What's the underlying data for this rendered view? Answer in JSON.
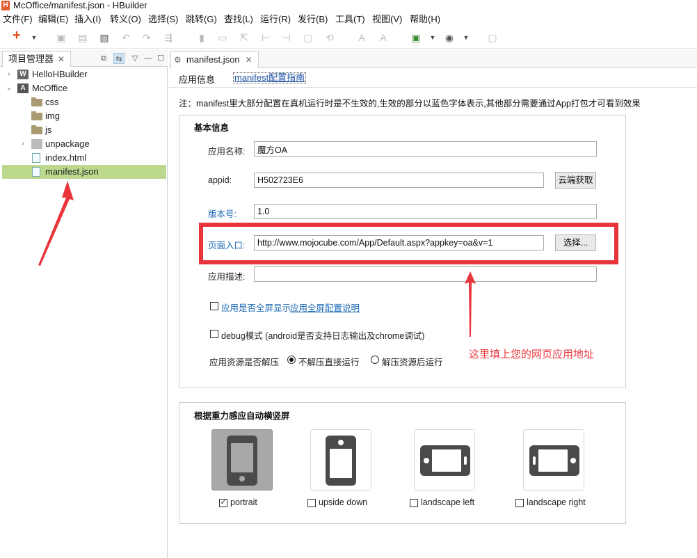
{
  "window": {
    "title": "McOffice/manifest.json  -  HBuilder",
    "app_icon": "H"
  },
  "menu": [
    "文件(F)",
    "编辑(E)",
    "插入(I)",
    "转义(O)",
    "选择(S)",
    "跳转(G)",
    "查找(L)",
    "运行(R)",
    "发行(B)",
    "工具(T)",
    "视图(V)",
    "帮助(H)"
  ],
  "left_panel": {
    "tab_label": "项目管理器",
    "tree": [
      {
        "label": "HelloHBuilder",
        "type": "project-w",
        "expanded": false
      },
      {
        "label": "McOffice",
        "type": "project-a",
        "expanded": true
      },
      {
        "label": "css",
        "type": "folder"
      },
      {
        "label": "img",
        "type": "folder"
      },
      {
        "label": "js",
        "type": "folder"
      },
      {
        "label": "unpackage",
        "type": "package",
        "expanded": false
      },
      {
        "label": "index.html",
        "type": "file"
      },
      {
        "label": "manifest.json",
        "type": "file",
        "selected": true
      }
    ]
  },
  "editor": {
    "tab_label": "manifest.json",
    "subtabs": {
      "app_info": "应用信息",
      "guide": "manifest配置指南"
    },
    "note": "注：manifest里大部分配置在真机运行时是不生效的,生效的部分以蓝色字体表示,其他部分需要通过App打包才可看到效果",
    "basic": {
      "title": "基本信息",
      "app_name_label": "应用名称:",
      "app_name_value": "魔方OA",
      "appid_label": "appid:",
      "appid_value": "H502723E6",
      "cloud_button": "云端获取",
      "version_label": "版本号:",
      "version_value": "1.0",
      "entry_label": "页面入口:",
      "entry_value": "http://www.mojocube.com/App/Default.aspx?appkey=oa&v=1",
      "select_button": "选择...",
      "desc_label": "应用描述:",
      "desc_value": "",
      "fullscreen_label": "应用是否全屏显示",
      "fullscreen_link": "应用全屏配置说明",
      "debug_label": "debug模式 (android是否支持日志输出及chrome调试)",
      "unpack_label": "应用资源是否解压",
      "unpack_option1": "不解压直接运行",
      "unpack_option2": "解压资源后运行"
    },
    "orientation": {
      "title": "根据重力感应自动横竖屏",
      "options": [
        {
          "label": "portrait",
          "checked": true
        },
        {
          "label": "upside down",
          "checked": false
        },
        {
          "label": "landscape left",
          "checked": false
        },
        {
          "label": "landscape right",
          "checked": false
        }
      ]
    }
  },
  "annotation": {
    "text": "这里填上您的网页应用地址",
    "color": "#e8353b"
  },
  "colors": {
    "selected_row": "#bcd98e",
    "blue_label": "#1b69b5",
    "highlight_red": "#e8353b"
  }
}
